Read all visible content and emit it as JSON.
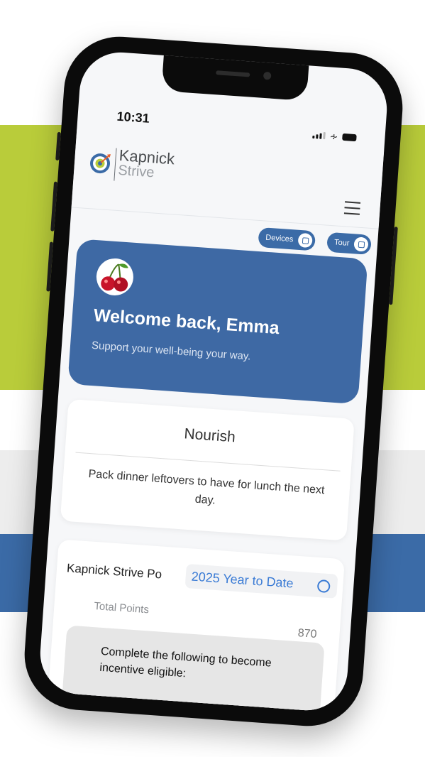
{
  "status_bar": {
    "time": "10:31"
  },
  "brand": {
    "name_line1": "Kapnick",
    "name_line2": "Strive"
  },
  "header": {
    "menu_icon": "hamburger-menu-icon"
  },
  "toggles": [
    {
      "label": "Devices",
      "icon": "square-icon"
    },
    {
      "label": "Tour",
      "icon": "square-icon"
    }
  ],
  "welcome": {
    "avatar_icon": "cherry-icon",
    "title": "Welcome back, Emma",
    "subtitle": "Support your well-being your way."
  },
  "tip": {
    "category": "Nourish",
    "text": "Pack dinner leftovers to have for lunch the next day."
  },
  "points": {
    "title": "Kapnick Strive Po",
    "period": "2025 Year to Date",
    "total_label": "Total Points",
    "total_value": "870",
    "incentive_text": "Complete the following to become incentive eligible:"
  },
  "colors": {
    "brand_blue": "#3e69a4",
    "brand_green": "#b9cc3a",
    "link_blue": "#3a7bd5"
  }
}
